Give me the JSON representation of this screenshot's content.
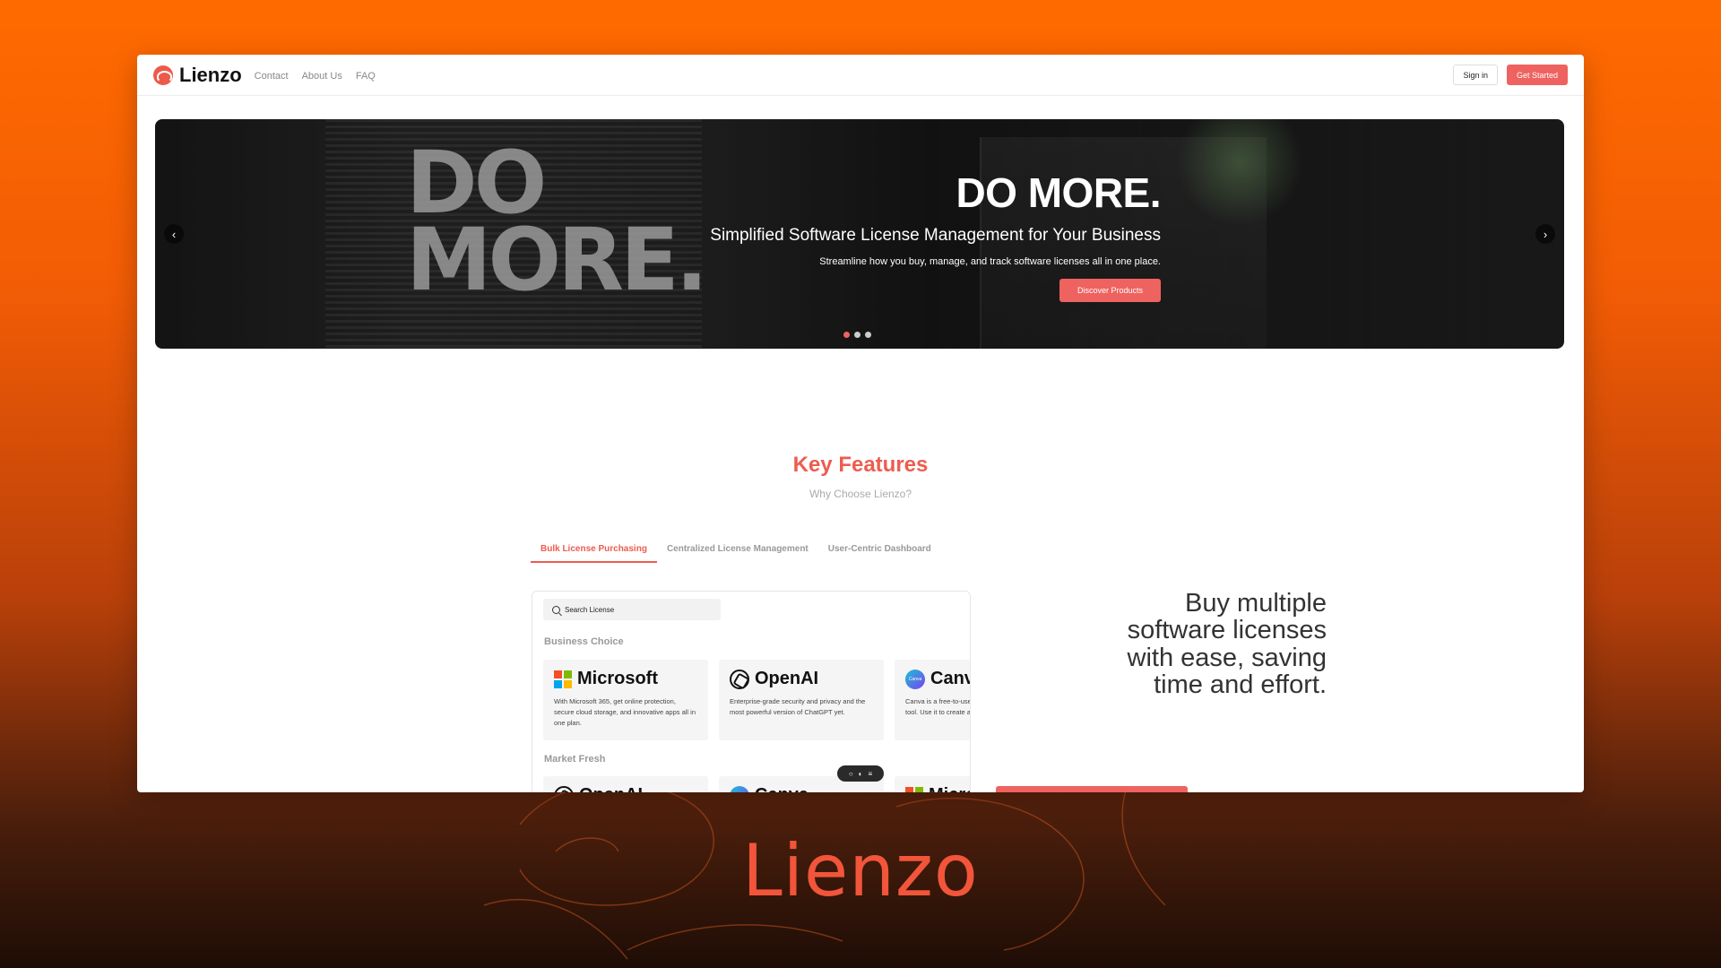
{
  "header": {
    "brand": "Lienzo",
    "nav": [
      "Contact",
      "About Us",
      "FAQ"
    ],
    "sign_in": "Sign in",
    "get_started": "Get Started"
  },
  "hero": {
    "wall_text_1": "DO",
    "wall_text_2": "MORE.",
    "title": "DO MORE.",
    "subtitle": "Simplified Software License Management for Your Business",
    "description": "Streamline how you buy, manage, and track software licenses all in one place.",
    "cta": "Discover Products",
    "prev_icon": "chevron-left-icon",
    "next_icon": "chevron-right-icon",
    "slide_count": 3,
    "active_slide": 1
  },
  "features": {
    "title": "Key Features",
    "subtitle": "Why Choose Lienzo?",
    "tabs": [
      "Bulk License Purchasing",
      "Centralized License Management",
      "User-Centric Dashboard"
    ],
    "active_tab": 0,
    "search_placeholder": "Search License",
    "sections": [
      {
        "label": "Business Choice",
        "cards": [
          {
            "name": "Microsoft",
            "icon": "microsoft-icon",
            "desc": "With Microsoft 365, get online protection, secure cloud storage, and innovative apps all in one plan."
          },
          {
            "name": "OpenAI",
            "icon": "openai-icon",
            "desc": "Enterprise-grade security and privacy and the most powerful version of ChatGPT yet."
          },
          {
            "name": "Canva",
            "icon": "canva-icon",
            "desc": "Canva is a free-to-use online graphic design tool. Use it to create and more."
          }
        ]
      },
      {
        "label": "Market Fresh",
        "cards": [
          {
            "name": "OpenAI",
            "icon": "openai-icon"
          },
          {
            "name": "Canva",
            "icon": "canva-icon"
          },
          {
            "name": "Microsoft",
            "icon": "microsoft-icon"
          }
        ]
      }
    ],
    "headline": "Buy multiple software licenses with ease, saving time and effort."
  },
  "colors": {
    "accent": "#ee6360",
    "background_top": "#ff6a00",
    "background_bottom": "#1e0d06"
  },
  "caption": "Lienzo"
}
